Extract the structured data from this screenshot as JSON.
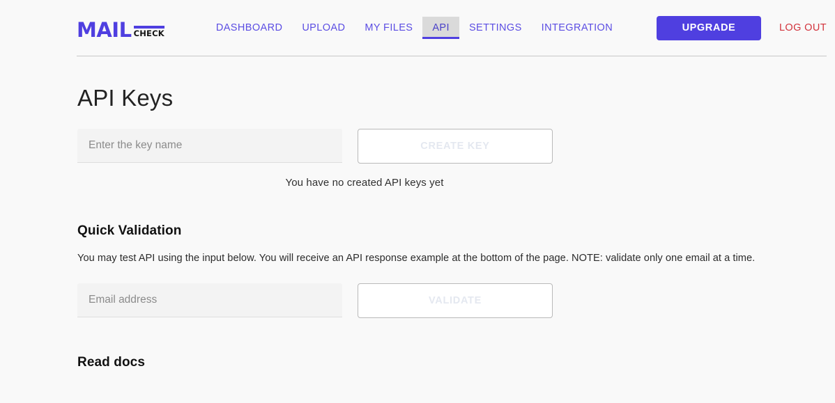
{
  "brand": {
    "name_primary": "MAIL",
    "name_secondary": "CHECK",
    "accent_color": "#4f3fe0"
  },
  "header": {
    "nav": [
      {
        "label": "DASHBOARD",
        "active": false
      },
      {
        "label": "UPLOAD",
        "active": false
      },
      {
        "label": "MY FILES",
        "active": false
      },
      {
        "label": "API",
        "active": true
      },
      {
        "label": "SETTINGS",
        "active": false
      },
      {
        "label": "INTEGRATION",
        "active": false
      }
    ],
    "upgrade_label": "UPGRADE",
    "logout_label": "LOG OUT",
    "logout_color": "#d2333c"
  },
  "main": {
    "page_title": "API Keys",
    "api_keys": {
      "key_name_value": "",
      "key_name_placeholder": "Enter the key name",
      "create_button_label": "CREATE KEY",
      "empty_message": "You have no created API keys yet"
    },
    "quick_validation": {
      "heading": "Quick Validation",
      "description": "You may test API using the input below. You will receive an API response example at the bottom of the page. NOTE: validate only one email at a time.",
      "email_value": "",
      "email_placeholder": "Email address",
      "validate_button_label": "VALIDATE"
    },
    "read_docs": {
      "heading": "Read docs"
    }
  }
}
